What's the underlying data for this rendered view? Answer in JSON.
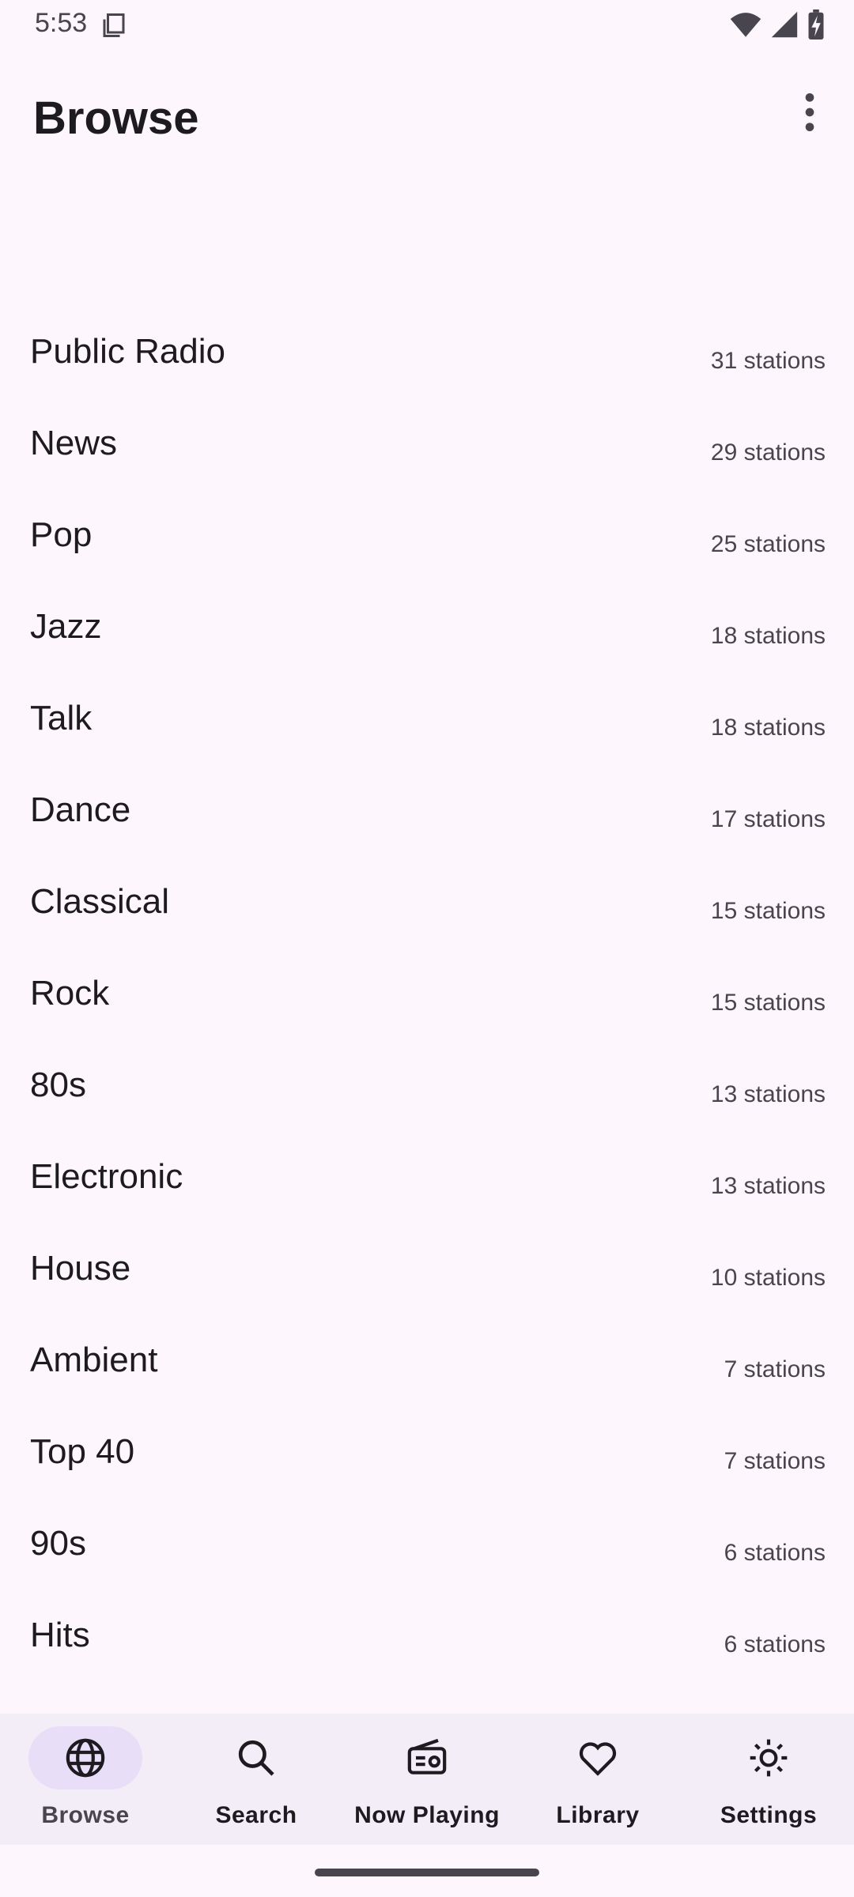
{
  "status": {
    "time": "5:53"
  },
  "header": {
    "title": "Browse"
  },
  "genres": [
    {
      "name": "Public Radio",
      "count": "31 stations"
    },
    {
      "name": "News",
      "count": "29 stations"
    },
    {
      "name": "Pop",
      "count": "25 stations"
    },
    {
      "name": "Jazz",
      "count": "18 stations"
    },
    {
      "name": "Talk",
      "count": "18 stations"
    },
    {
      "name": "Dance",
      "count": "17 stations"
    },
    {
      "name": "Classical",
      "count": "15 stations"
    },
    {
      "name": "Rock",
      "count": "15 stations"
    },
    {
      "name": "80s",
      "count": "13 stations"
    },
    {
      "name": "Electronic",
      "count": "13 stations"
    },
    {
      "name": "House",
      "count": "10 stations"
    },
    {
      "name": "Ambient",
      "count": "7 stations"
    },
    {
      "name": "Top 40",
      "count": "7 stations"
    },
    {
      "name": "90s",
      "count": "6 stations"
    },
    {
      "name": "Hits",
      "count": "6 stations"
    }
  ],
  "nav": {
    "items": [
      {
        "label": "Browse",
        "icon": "globe-icon",
        "active": true
      },
      {
        "label": "Search",
        "icon": "search-icon",
        "active": false
      },
      {
        "label": "Now Playing",
        "icon": "radio-icon",
        "active": false
      },
      {
        "label": "Library",
        "icon": "heart-icon",
        "active": false
      },
      {
        "label": "Settings",
        "icon": "brightness-icon",
        "active": false
      }
    ]
  },
  "colors": {
    "background": "#fdf7fd",
    "nav_background": "#f3edf7",
    "active_pill": "#e8def8",
    "text_primary": "#1d1b20",
    "text_secondary": "#49454f"
  }
}
